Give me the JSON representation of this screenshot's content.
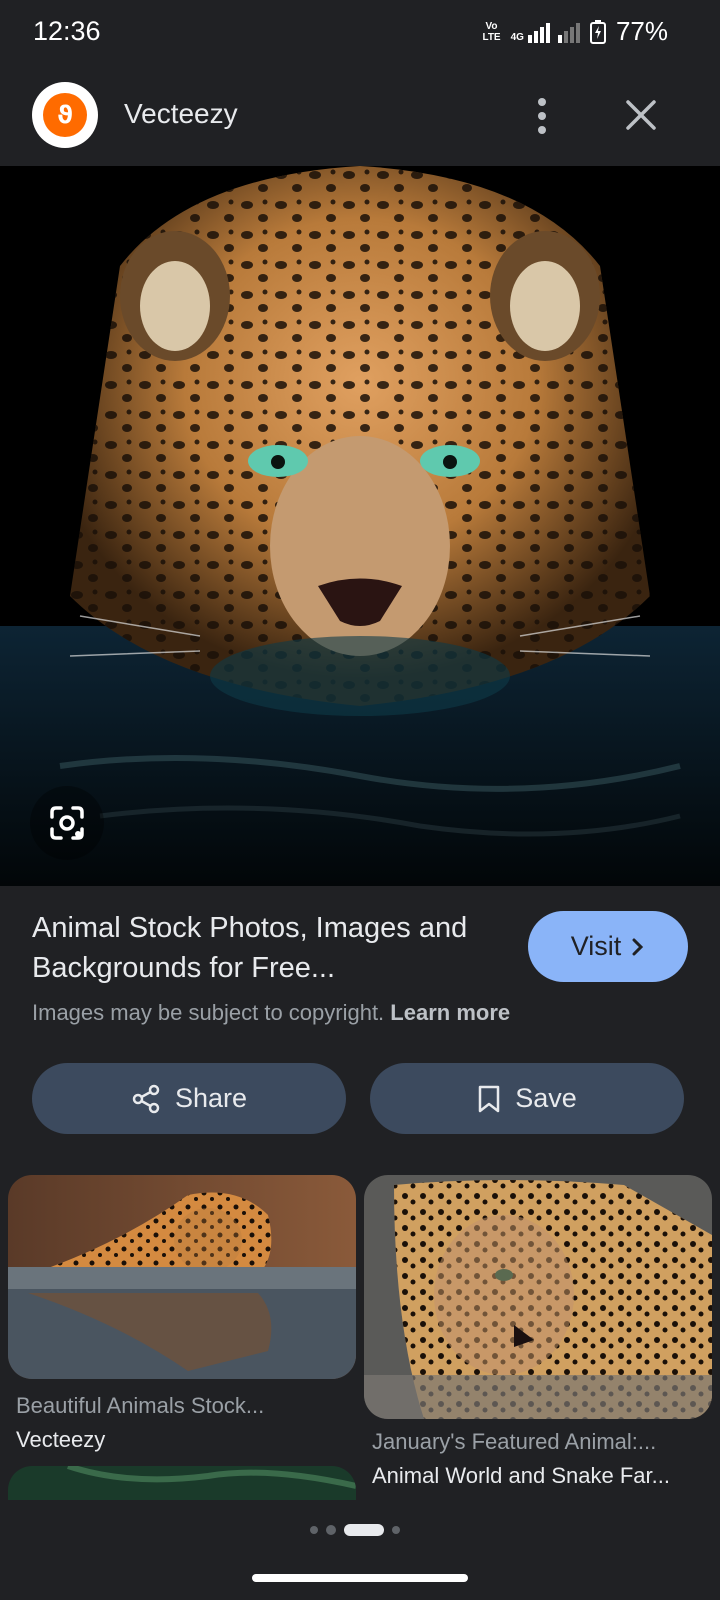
{
  "status_bar": {
    "time": "12:36",
    "network_top": "Vo",
    "network_bottom": "LTE",
    "network_gen": "4G",
    "battery_percent": "77%"
  },
  "header": {
    "site_name": "Vecteezy",
    "logo_icon": "vecteezy-logo-icon",
    "more_icon": "more-vert-icon",
    "close_icon": "close-icon"
  },
  "result": {
    "title": "Animal Stock Photos, Images and Backgrounds for Free...",
    "visit_label": "Visit",
    "copyright_text": "Images may be subject to copyright.",
    "learn_more": "Learn more",
    "share_label": "Share",
    "save_label": "Save"
  },
  "related": [
    {
      "title": "Beautiful Animals Stock...",
      "source": "Vecteezy"
    },
    {
      "title": "January's Featured Animal:...",
      "source": "Animal World and Snake Far..."
    }
  ],
  "pager": {
    "active_index": 2,
    "count": 4
  },
  "colors": {
    "background": "#202124",
    "accent": "#8ab4f8",
    "button_bg": "#3c4a5e",
    "brand": "#ff6b00"
  }
}
